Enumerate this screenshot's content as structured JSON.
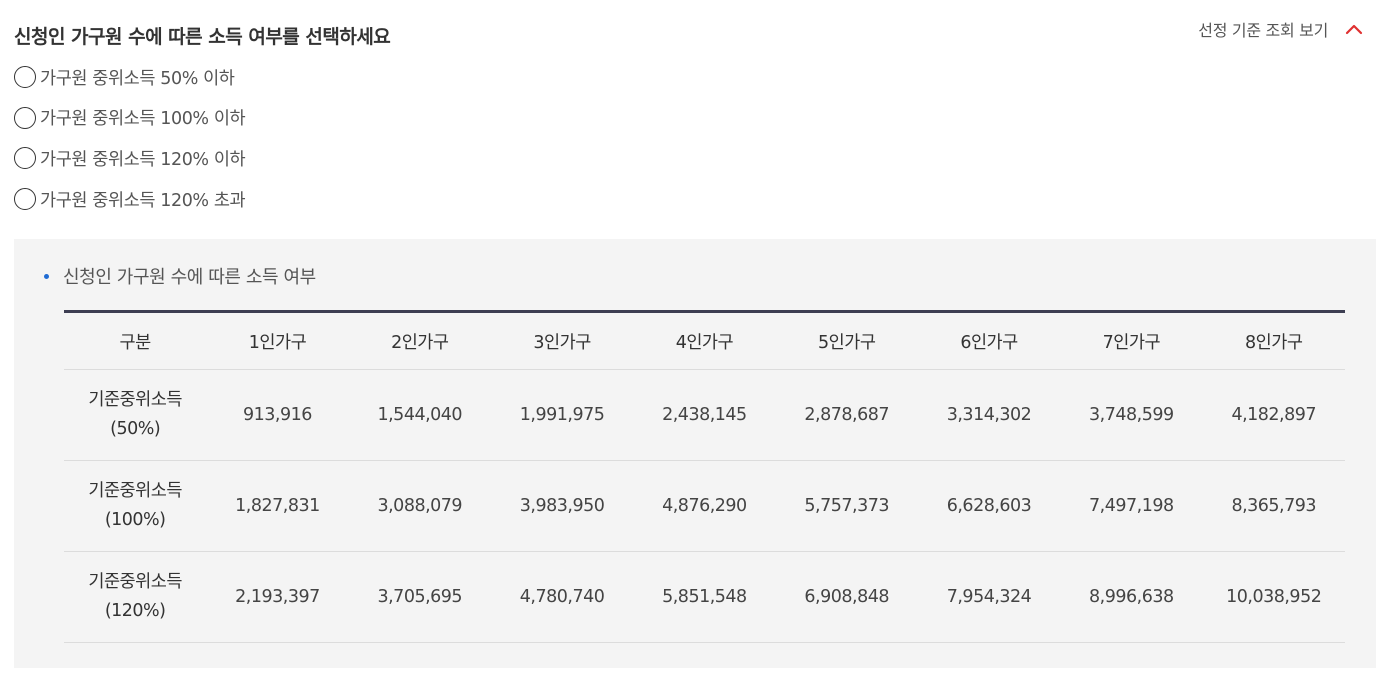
{
  "question": "신청인 가구원 수에 따른 소득 여부를 선택하세요",
  "toggle": {
    "label": "선정 기준 조회 보기",
    "icon": "chevron-up-icon",
    "icon_color": "#e03131"
  },
  "options": [
    {
      "label": "가구원 중위소득 50% 이하",
      "selected": false
    },
    {
      "label": "가구원 중위소득 100% 이하",
      "selected": false
    },
    {
      "label": "가구원 중위소득 120% 이하",
      "selected": false
    },
    {
      "label": "가구원 중위소득 120% 초과",
      "selected": false
    }
  ],
  "panel": {
    "title": "신청인 가구원 수에 따른 소득 여부",
    "bullet_color": "#1f6bd3"
  },
  "table": {
    "headers": [
      "구분",
      "1인가구",
      "2인가구",
      "3인가구",
      "4인가구",
      "5인가구",
      "6인가구",
      "7인가구",
      "8인가구"
    ],
    "rows": [
      {
        "label": "기준중위소득",
        "sub": "(50%)",
        "values": [
          "913,916",
          "1,544,040",
          "1,991,975",
          "2,438,145",
          "2,878,687",
          "3,314,302",
          "3,748,599",
          "4,182,897"
        ]
      },
      {
        "label": "기준중위소득",
        "sub": "(100%)",
        "values": [
          "1,827,831",
          "3,088,079",
          "3,983,950",
          "4,876,290",
          "5,757,373",
          "6,628,603",
          "7,497,198",
          "8,365,793"
        ]
      },
      {
        "label": "기준중위소득",
        "sub": "(120%)",
        "values": [
          "2,193,397",
          "3,705,695",
          "4,780,740",
          "5,851,548",
          "6,908,848",
          "7,954,324",
          "8,996,638",
          "10,038,952"
        ]
      }
    ]
  },
  "colors": {
    "table_top_border": "#3d3e52",
    "panel_background": "#f4f4f4"
  }
}
